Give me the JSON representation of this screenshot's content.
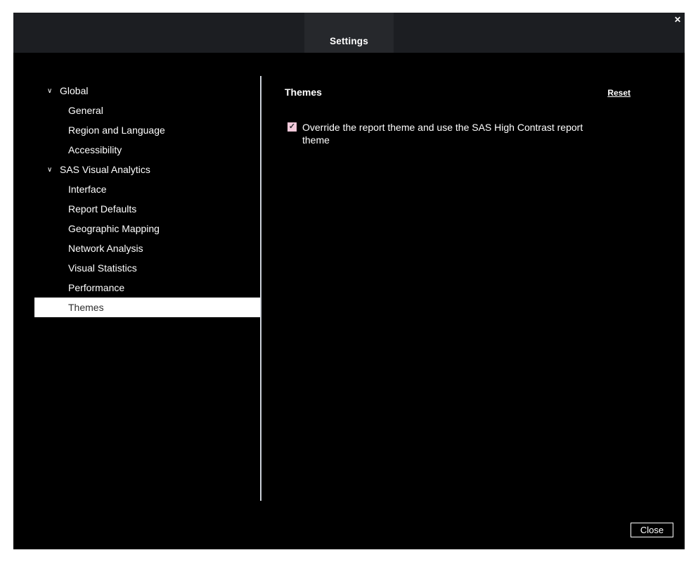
{
  "dialog": {
    "title": "Settings",
    "close_icon": "✕"
  },
  "sidebar": {
    "chevron_icon": "∨",
    "items": [
      {
        "label": "Global",
        "type": "group",
        "expanded": true,
        "selected": false
      },
      {
        "label": "General",
        "type": "child",
        "selected": false
      },
      {
        "label": "Region and Language",
        "type": "child",
        "selected": false
      },
      {
        "label": "Accessibility",
        "type": "child",
        "selected": false
      },
      {
        "label": "SAS Visual Analytics",
        "type": "group",
        "expanded": true,
        "selected": false
      },
      {
        "label": "Interface",
        "type": "child",
        "selected": false
      },
      {
        "label": "Report Defaults",
        "type": "child",
        "selected": false
      },
      {
        "label": "Geographic Mapping",
        "type": "child",
        "selected": false
      },
      {
        "label": "Network Analysis",
        "type": "child",
        "selected": false
      },
      {
        "label": "Visual Statistics",
        "type": "child",
        "selected": false
      },
      {
        "label": "Performance",
        "type": "child",
        "selected": false
      },
      {
        "label": "Themes",
        "type": "child",
        "selected": true
      }
    ]
  },
  "panel": {
    "heading": "Themes",
    "reset_label": "Reset",
    "checkbox": {
      "checked": true,
      "check_icon": "✓",
      "label": "Override the report theme and use the SAS High Contrast report theme"
    }
  },
  "footer": {
    "close_label": "Close"
  },
  "colors": {
    "header_bg": "#1c1e22",
    "body_bg": "#000000",
    "selected_row_bg": "#ffffff",
    "selected_row_text": "#2e2e2e",
    "checkbox_bg": "#f2c9da",
    "divider": "#ccd1d9"
  }
}
